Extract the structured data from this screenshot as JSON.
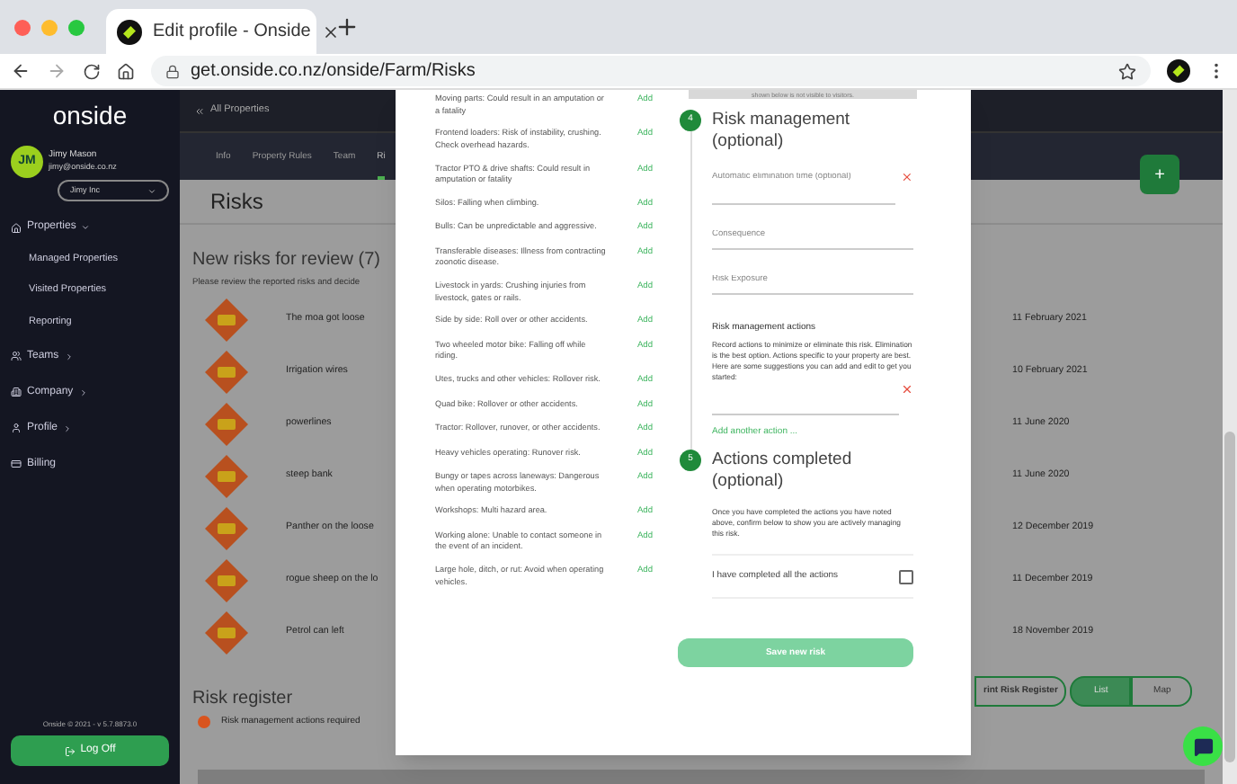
{
  "browser": {
    "tab_title": "Edit profile - Onside",
    "url": "get.onside.co.nz/onside/Farm/Risks"
  },
  "sidebar": {
    "logo": "onside",
    "user": {
      "initials": "JM",
      "name": "Jimy Mason",
      "email": "jimy@onside.co.nz"
    },
    "organisation": "Jimy Inc",
    "items": [
      {
        "label": "Properties",
        "expanded": true,
        "children": [
          {
            "label": "Managed Properties"
          },
          {
            "label": "Visited Properties"
          },
          {
            "label": "Reporting"
          }
        ]
      },
      {
        "label": "Teams",
        "expanded": false
      },
      {
        "label": "Company",
        "expanded": false
      },
      {
        "label": "Profile",
        "expanded": false
      },
      {
        "label": "Billing"
      }
    ],
    "version": "Onside © 2021 - v 5.7.8873.0",
    "logout": "Log Off"
  },
  "header": {
    "back": "All Properties",
    "tabs": [
      {
        "label": "Info",
        "selected": false
      },
      {
        "label": "Property Rules",
        "selected": false
      },
      {
        "label": "Team",
        "selected": false
      },
      {
        "label": "Ri",
        "selected": true
      }
    ]
  },
  "page": {
    "title": "Risks",
    "add_button": "+",
    "review_title": "New risks for review (7)",
    "review_subtitle": "Please review the reported risks and decide",
    "risks": [
      {
        "name": "The moa got loose",
        "date": "11 February 2021"
      },
      {
        "name": "Irrigation wires",
        "date": "10 February 2021"
      },
      {
        "name": "powerlines",
        "date": "11 June 2020"
      },
      {
        "name": "steep bank",
        "date": "11 June 2020"
      },
      {
        "name": "Panther on the loose",
        "date": "12 December 2019"
      },
      {
        "name": "rogue sheep on the lo",
        "date": "11 December 2019"
      },
      {
        "name": "Petrol can left",
        "date": "18 November 2019"
      }
    ],
    "register_title": "Risk register",
    "legend": {
      "label": "Risk management actions required",
      "color": "#d9541e"
    },
    "print_button": "rint Risk Register",
    "views": [
      {
        "label": "List",
        "selected": true
      },
      {
        "label": "Map",
        "selected": false
      }
    ]
  },
  "modal": {
    "suggestions": [
      {
        "text": "Moving parts: Could result in an amputation or a fatality",
        "action": "Add"
      },
      {
        "text": "Frontend loaders: Risk of instability, crushing. Check overhead hazards.",
        "action": "Add"
      },
      {
        "text": "Tractor PTO & drive shafts: Could result in amputation or fatality",
        "action": "Add"
      },
      {
        "text": "Silos: Falling when climbing.",
        "action": "Add"
      },
      {
        "text": "Bulls: Can be unpredictable and aggressive.",
        "action": "Add"
      },
      {
        "text": "Transferable diseases: Illness from contracting zoonotic disease.",
        "action": "Add"
      },
      {
        "text": "Livestock in yards: Crushing injuries from livestock, gates or rails.",
        "action": "Add"
      },
      {
        "text": "Side by side: Roll over or other accidents.",
        "action": "Add"
      },
      {
        "text": "Two wheeled motor bike: Falling off while riding.",
        "action": "Add"
      },
      {
        "text": "Utes, trucks and other vehicles: Rollover risk.",
        "action": "Add"
      },
      {
        "text": "Quad bike: Rollover or other accidents.",
        "action": "Add"
      },
      {
        "text": "Tractor: Rollover, runover, or other accidents.",
        "action": "Add"
      },
      {
        "text": "Heavy vehicles operating: Runover risk.",
        "action": "Add"
      },
      {
        "text": "Bungy or tapes across laneways: Dangerous when operating motorbikes.",
        "action": "Add"
      },
      {
        "text": "Workshops: Multi hazard area.",
        "action": "Add"
      },
      {
        "text": "Working alone: Unable to contact someone in the event of an incident.",
        "action": "Add"
      },
      {
        "text": "Large hole, ditch, or rut: Avoid when operating vehicles.",
        "action": "Add"
      }
    ],
    "notice": "shown below is not visible to visitors.",
    "step4": {
      "number": "4",
      "title": "Risk management (optional)",
      "fields": [
        {
          "placeholder": "Automatic elimination time (optional)",
          "clearable": true
        },
        {
          "placeholder": "Consequence",
          "clearable": false
        },
        {
          "placeholder": "Risk Exposure",
          "clearable": false
        }
      ],
      "actions_title": "Risk management actions",
      "actions_text": "Record actions to minimize or eliminate this risk. Elimination is the best option. Actions specific to your property are best. Here are some suggestions you can add and edit to get you started:",
      "add_action": "Add another action ..."
    },
    "step5": {
      "number": "5",
      "title": "Actions completed (optional)",
      "text": "Once you have completed the actions you have noted above, confirm below to show you are actively managing this risk.",
      "checkbox": {
        "label": "I have completed all the actions",
        "checked": false
      }
    },
    "save_button": {
      "label": "Save new risk",
      "disabled": true
    }
  }
}
